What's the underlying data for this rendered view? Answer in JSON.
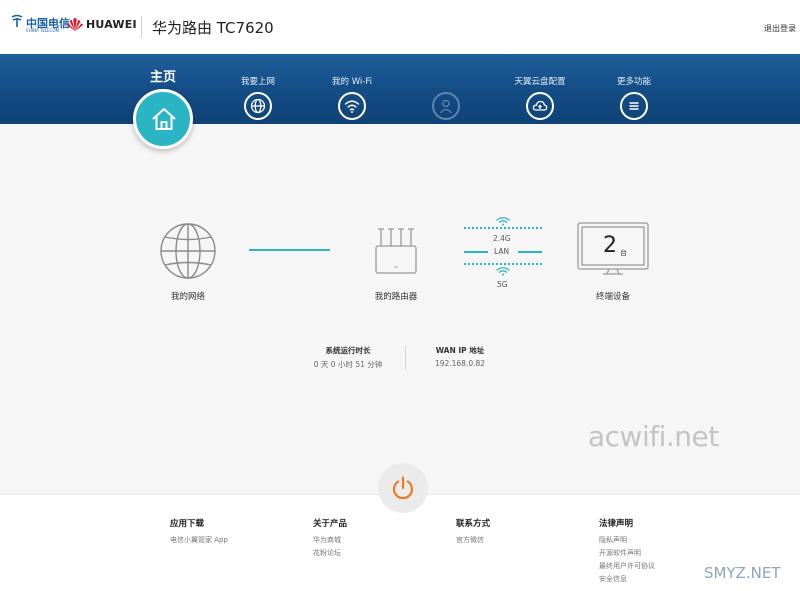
{
  "header": {
    "telecom_name": "中国电信",
    "telecom_sub": "CHINA TELECOM",
    "brand": "HUAWEI",
    "title": "华为路由 TC7620",
    "logout": "退出登录"
  },
  "nav": {
    "home_label": "主页",
    "items": [
      {
        "label": "我要上网",
        "icon": "globe-icon"
      },
      {
        "label": "我的 Wi-Fi",
        "icon": "wifi-icon"
      },
      {
        "label": "",
        "icon": "user-icon"
      },
      {
        "label": "天翼云盘配置",
        "icon": "cloud-icon"
      },
      {
        "label": "更多功能",
        "icon": "menu-icon"
      }
    ]
  },
  "topology": {
    "internet_label": "我的网络",
    "router_label": "我的路由器",
    "band_24": "2.4G",
    "band_lan": "LAN",
    "band_5": "5G",
    "devices_count": "2",
    "devices_unit": "台",
    "devices_label": "终端设备"
  },
  "stats": {
    "uptime_title": "系统运行时长",
    "uptime_value": "0 天 0 小时 51 分钟",
    "wan_title": "WAN IP 地址",
    "wan_value": "192.168.0.82"
  },
  "watermarks": {
    "acwifi": "acwifi.net",
    "smyz": "SMYZ.NET"
  },
  "footer": {
    "columns": [
      {
        "title": "应用下载",
        "links": [
          "电信小翼管家 App"
        ]
      },
      {
        "title": "关于产品",
        "links": [
          "华为商城",
          "花粉论坛"
        ]
      },
      {
        "title": "联系方式",
        "links": [
          "官方微信"
        ]
      },
      {
        "title": "法律声明",
        "links": [
          "隐私声明",
          "开源软件声明",
          "最终用户许可协议",
          "安全信息"
        ]
      }
    ]
  },
  "colors": {
    "nav_blue": "#164d85",
    "accent_teal": "#2bb5c4",
    "power_orange": "#f07a22",
    "huawei_red": "#e0162b",
    "telecom_blue": "#1a5faa"
  }
}
